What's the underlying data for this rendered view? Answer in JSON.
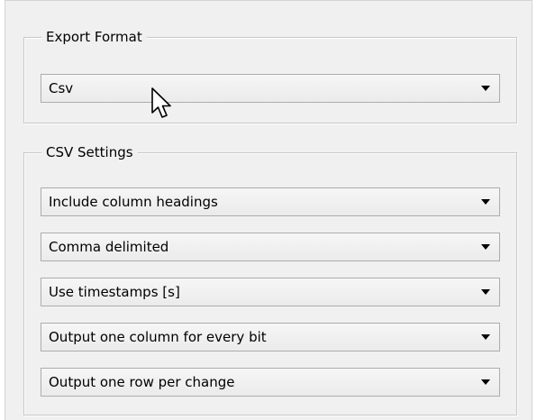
{
  "export_format": {
    "legend": "Export Format",
    "selected": "Csv"
  },
  "csv_settings": {
    "legend": "CSV Settings",
    "options": [
      {
        "value": "Include column headings"
      },
      {
        "value": "Comma delimited"
      },
      {
        "value": "Use timestamps [s]"
      },
      {
        "value": "Output one column for every bit"
      },
      {
        "value": "Output one row per change"
      }
    ]
  },
  "icons": {
    "dropdown": "triangle-down-icon",
    "cursor": "mouse-pointer-icon"
  }
}
